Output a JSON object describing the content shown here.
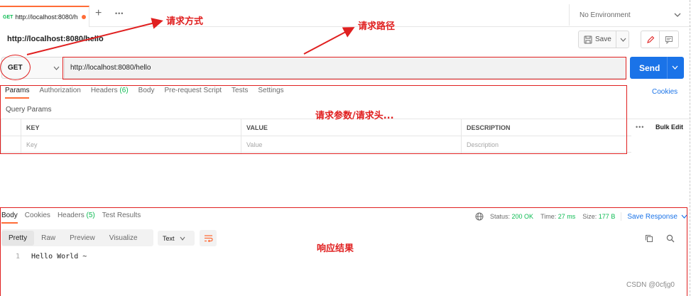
{
  "tabbar": {
    "tab_method": "GET",
    "tab_title": "http://localhost:8080/h",
    "new_tab": "+",
    "more": "•••",
    "environment": "No Environment"
  },
  "request": {
    "name": "http://localhost:8080/hello",
    "save_label": "Save",
    "method": "GET",
    "url": "http://localhost:8080/hello",
    "send_label": "Send"
  },
  "request_tabs": [
    {
      "label": "Params",
      "count": ""
    },
    {
      "label": "Authorization",
      "count": ""
    },
    {
      "label": "Headers",
      "count": "(6)"
    },
    {
      "label": "Body",
      "count": ""
    },
    {
      "label": "Pre-request Script",
      "count": ""
    },
    {
      "label": "Tests",
      "count": ""
    },
    {
      "label": "Settings",
      "count": ""
    }
  ],
  "cookies_link": "Cookies",
  "query_params": {
    "title": "Query Params",
    "headers": [
      "KEY",
      "VALUE",
      "DESCRIPTION"
    ],
    "placeholders": [
      "Key",
      "Value",
      "Description"
    ],
    "more": "•••",
    "bulk_edit": "Bulk Edit"
  },
  "response": {
    "tabs": [
      {
        "label": "Body",
        "count": ""
      },
      {
        "label": "Cookies",
        "count": ""
      },
      {
        "label": "Headers",
        "count": "(5)"
      },
      {
        "label": "Test Results",
        "count": ""
      }
    ],
    "status_label": "Status:",
    "status_value": "200 OK",
    "time_label": "Time:",
    "time_value": "27 ms",
    "size_label": "Size:",
    "size_value": "177 B",
    "save_response": "Save Response",
    "view_tabs": [
      "Pretty",
      "Raw",
      "Preview",
      "Visualize"
    ],
    "format": "Text",
    "body_lines": [
      {
        "num": "1",
        "text": "Hello World ~"
      }
    ]
  },
  "annotations": {
    "method": "请求方式",
    "path": "请求路径",
    "params": "请求参数/请求头...",
    "response": "响应结果"
  },
  "watermark": "CSDN @0cfjg0",
  "colors": {
    "accent": "#ff6c37",
    "primary": "#1a73e8",
    "success": "#0cbb52",
    "annotation": "#e02020"
  }
}
